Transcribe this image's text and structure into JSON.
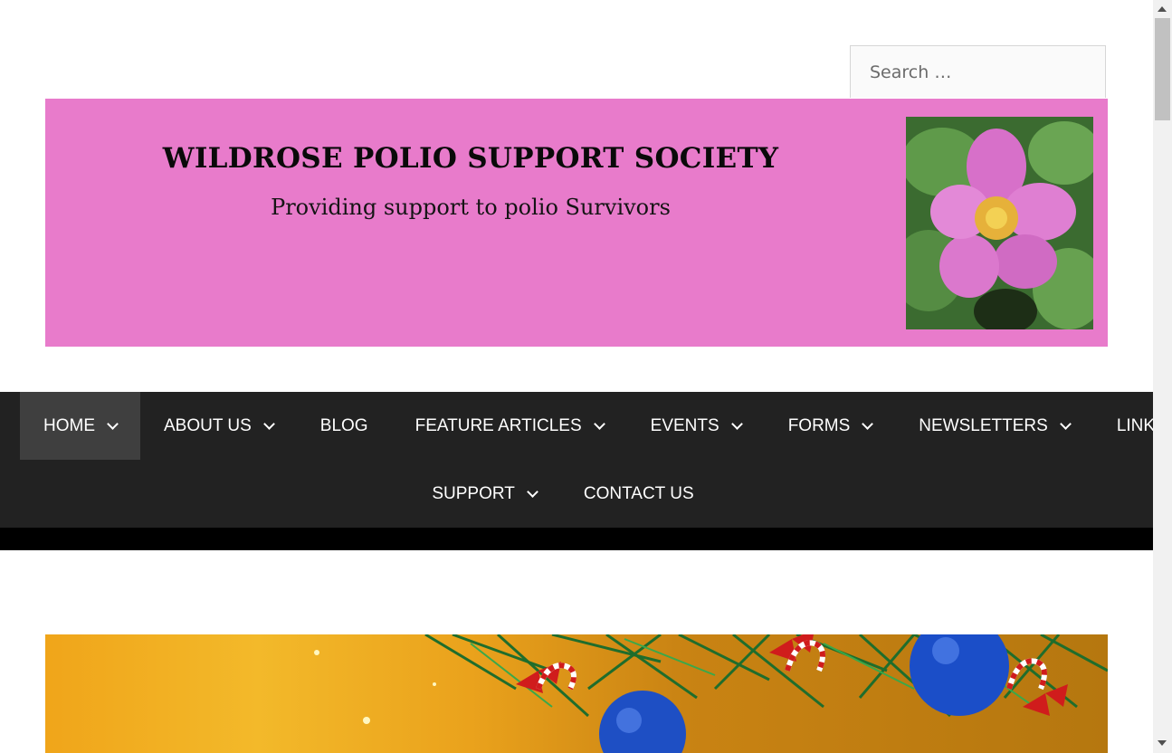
{
  "search": {
    "placeholder": "Search …"
  },
  "banner": {
    "title": "WILDROSE POLIO SUPPORT SOCIETY",
    "subtitle": "Providing support to polio Survivors",
    "image_icon": "wild-rose-flower",
    "background_color": "#e87bcb"
  },
  "nav": {
    "row1": [
      {
        "label": "HOME",
        "has_dropdown": true,
        "active": true
      },
      {
        "label": "ABOUT US",
        "has_dropdown": true
      },
      {
        "label": "BLOG",
        "has_dropdown": false
      },
      {
        "label": "FEATURE ARTICLES",
        "has_dropdown": true
      },
      {
        "label": "EVENTS",
        "has_dropdown": true
      },
      {
        "label": "FORMS",
        "has_dropdown": true
      },
      {
        "label": "NEWSLETTERS",
        "has_dropdown": true
      },
      {
        "label": "LINKS",
        "has_dropdown": true
      }
    ],
    "row2": [
      {
        "label": "SUPPORT",
        "has_dropdown": true
      },
      {
        "label": "CONTACT US",
        "has_dropdown": false
      }
    ],
    "background_color": "#222222",
    "active_color": "#3f3f3f"
  },
  "featured_image": {
    "icon": "christmas-ornaments-image"
  }
}
